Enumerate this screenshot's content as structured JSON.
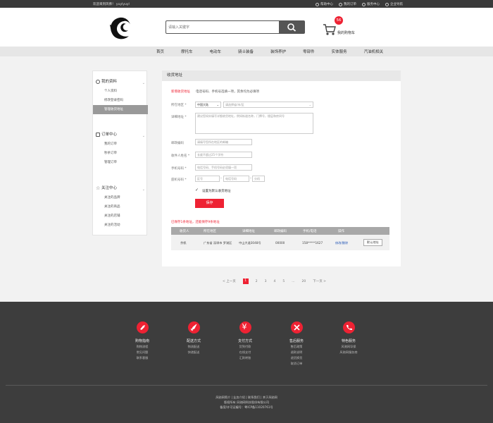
{
  "topbar": {
    "welcome": "欢迎来到风佛！ yuylyuyl",
    "links": [
      "帮助中心",
      "我的订单",
      "服务中心",
      "企业导航"
    ]
  },
  "header": {
    "search_placeholder": "请输入关键字",
    "cart_count": "56",
    "cart_label": "我的购物车"
  },
  "nav": [
    "首页",
    "摩托车",
    "电动车",
    "骑士装备",
    "装饰养护",
    "零部件",
    "实体服务",
    "汽油机相关"
  ],
  "sidebar": {
    "groups": [
      {
        "title": "我的资料",
        "items": [
          "个人资料",
          "修改登录密码",
          "管理收货地址"
        ],
        "active": 2
      },
      {
        "title": "订单中心",
        "items": [
          "我的订单",
          "秒杀订单",
          "管理订单"
        ],
        "active": -1
      },
      {
        "title": "关注中心",
        "items": [
          "关注的品牌",
          "关注的商品",
          "关注的店铺",
          "关注的活动"
        ],
        "active": -1
      }
    ]
  },
  "main": {
    "title": "收货地址",
    "add_link": "新增收货地址",
    "note": "电话号码、手机号选填一项，其余均为必填项",
    "region_label": "所在地区 *",
    "region_country": "中国大陆",
    "region_select": "请选择省/市/区",
    "detail_label": "详细地址 *",
    "detail_placeholder": "建议您如实填写详细收货地址，例如街道名称，门牌号，楼层和房间号",
    "zip_label": "邮政编码",
    "zip_placeholder": "请填写您所在地区的邮编",
    "name_label": "收件人姓名 *",
    "name_placeholder": "长度不超过25个字符",
    "mobile_label": "手机号码 *",
    "mobile_placeholder": "电话号码、手机号码必须填一项",
    "phone_label": "座机号码 *",
    "phone_area": "区号",
    "phone_number": "电话号码",
    "phone_ext": "分机",
    "default_label": "设置为默认收货地址",
    "save_label": "保存",
    "saved_note": "已保存1条地址，还能保存9条地址"
  },
  "table": {
    "headers": [
      "收货人",
      "所在地区",
      "详细地址",
      "邮政编码",
      "手机/电话",
      "操作"
    ],
    "rows": [
      {
        "name": "余帆",
        "region": "广东省 深圳市 罗湖区",
        "address": "中山大道3048号",
        "zip": "00000",
        "phone": "158*****1627",
        "ops": "修改/删除",
        "default": "默认地址"
      }
    ]
  },
  "pager": {
    "prev": "< 上一页",
    "pages": [
      "1",
      "2",
      "3",
      "4",
      "5",
      "...",
      "20"
    ],
    "next": "下一页 >"
  },
  "footer": {
    "cols": [
      {
        "title": "购物指南",
        "items": [
          "购物流程",
          "常见问题",
          "联系客服"
        ]
      },
      {
        "title": "配送方式",
        "items": [
          "物流配送",
          "快递配送"
        ]
      },
      {
        "title": "支付方式",
        "items": [
          "货到付款",
          "在线支付",
          "汇款转账"
        ]
      },
      {
        "title": "售后服务",
        "items": [
          "售后政策",
          "退款说明",
          "退货换货",
          "取消订单"
        ]
      },
      {
        "title": "特色服务",
        "items": [
          "风驰网导保",
          "风驰网服务商"
        ]
      }
    ],
    "links": "风驰网简介 | 业务介绍 | 联系我们 | 关于风驰网",
    "copyright": "版权所有 风驰网科技股份有限公司",
    "icp": "备案/许可证编号：粤ICP备11020761号"
  }
}
